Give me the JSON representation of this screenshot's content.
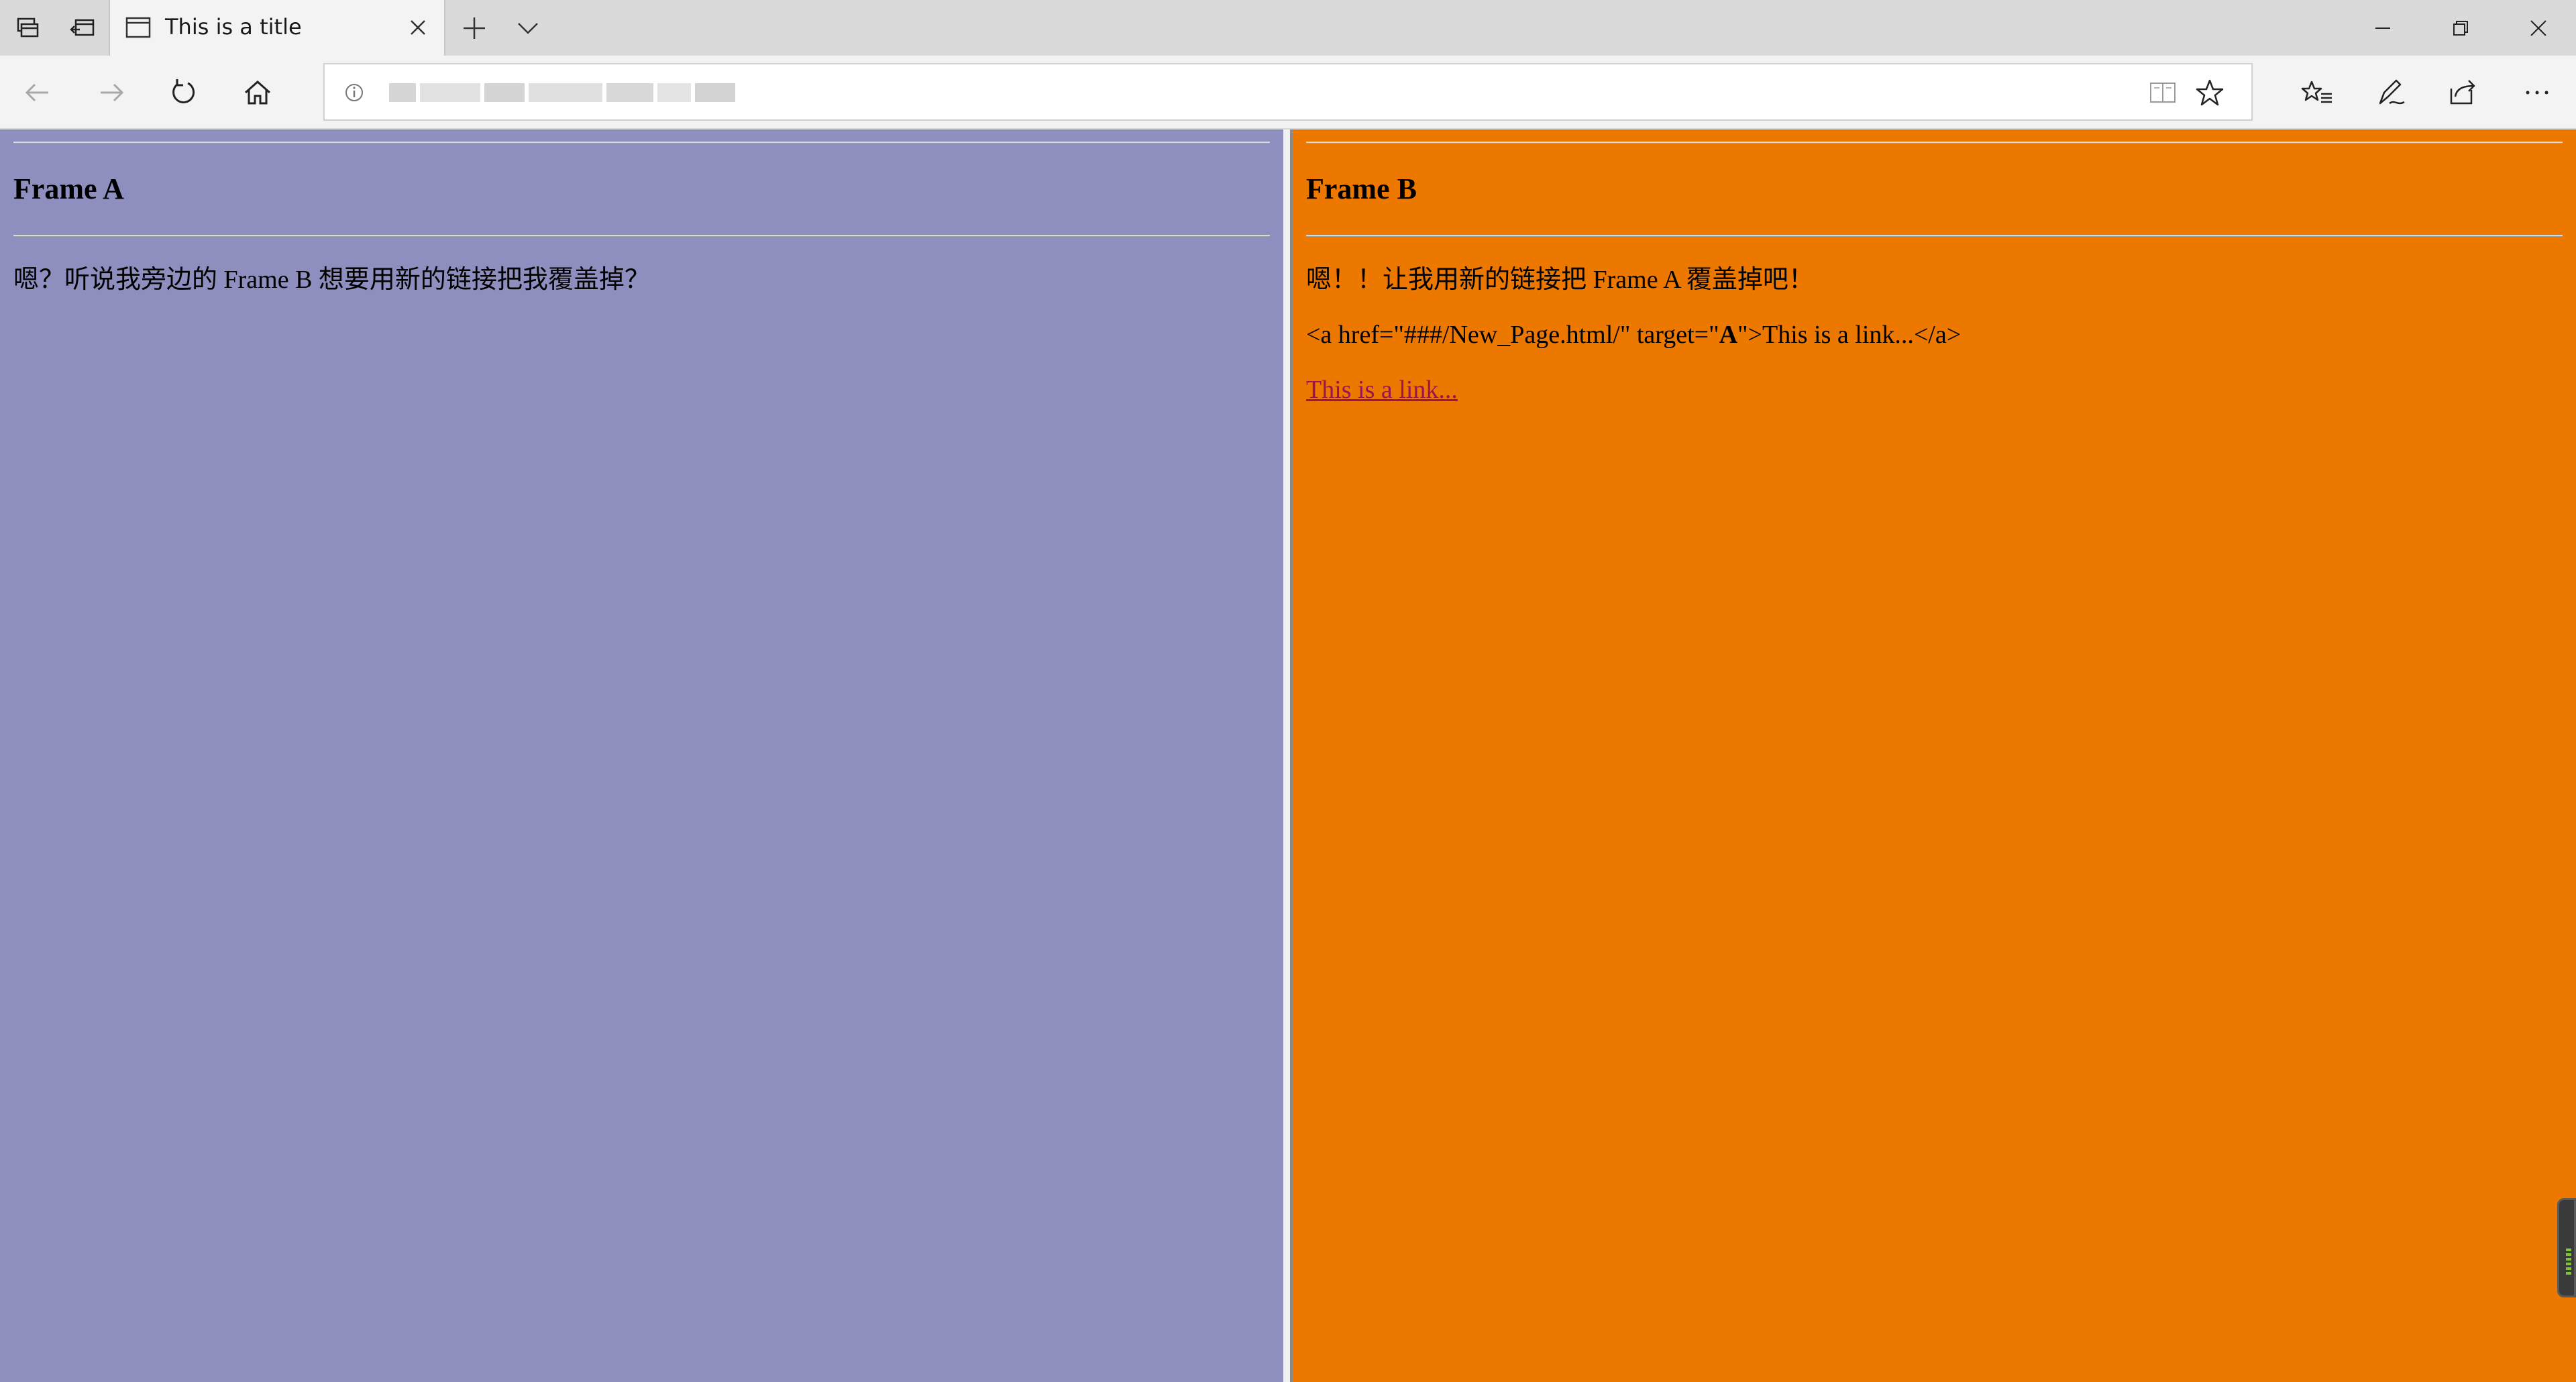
{
  "browser": {
    "tab": {
      "title": "This is a title"
    },
    "address_bar": {
      "url": ""
    }
  },
  "frame_a": {
    "heading": "Frame A",
    "text": "嗯？听说我旁边的 Frame B 想要用新的链接把我覆盖掉？"
  },
  "frame_b": {
    "heading": "Frame B",
    "text": "嗯！！让我用新的链接把 Frame A 覆盖掉吧！",
    "code_before": "<a href=\"###/New_Page.html/\" target=\"",
    "code_target": "A",
    "code_after": "\">This is a link...</a>",
    "link_label": "This is a link..."
  },
  "colors": {
    "frame_a_bg": "#8e8fbf",
    "frame_b_bg": "#ec7800",
    "link": "#9a1452"
  }
}
